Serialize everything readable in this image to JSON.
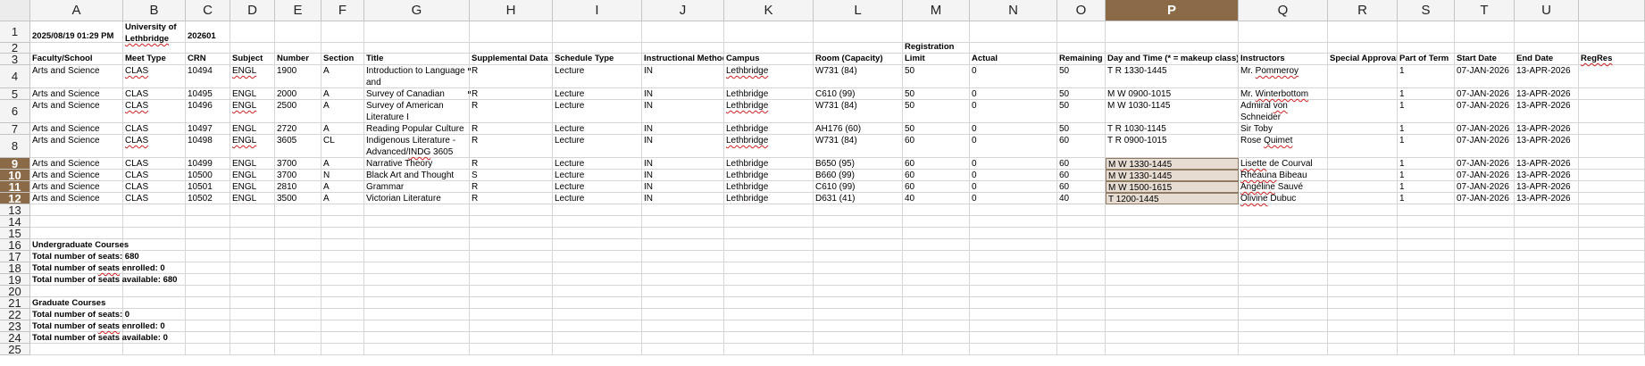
{
  "sheet": {
    "active_column": "P",
    "active_rows": [
      9,
      10,
      11,
      12
    ],
    "columns": [
      "A",
      "B",
      "C",
      "D",
      "E",
      "F",
      "G",
      "H",
      "I",
      "J",
      "K",
      "L",
      "M",
      "N",
      "O",
      "P",
      "Q",
      "R",
      "S",
      "T",
      "U"
    ],
    "rows": [
      1,
      2,
      3,
      4,
      5,
      6,
      7,
      8,
      9,
      10,
      11,
      12,
      13,
      14,
      15,
      16,
      17,
      18,
      19,
      20,
      21,
      22,
      23,
      24,
      25
    ],
    "meta_row": {
      "A": "2025/08/19 01:29 PM",
      "B": "University of Lethbridge",
      "C": "202601"
    },
    "headers": {
      "A": "Faculty/School",
      "B": "Meet Type",
      "C": "CRN",
      "D": "Subject",
      "E": "Number",
      "F": "Section",
      "G": "Title",
      "H": "Supplemental Data",
      "I": "Schedule Type",
      "J": "Instructional Method",
      "K": "Campus",
      "L": "Room (Capacity)",
      "M": "Registration Limit",
      "N": "Actual",
      "O": "Remaining",
      "P": "Day and Time (* = makeup class)",
      "Q": "Instructors",
      "R": "Special Approval",
      "S": "Part of Term",
      "T": "Start Date",
      "U": "End Date",
      "V": "RegRes"
    },
    "data_rows": [
      {
        "row": 4,
        "A": "Arts and Science",
        "B": "CLAS",
        "C": "10494",
        "D": "ENGL",
        "E": "1900",
        "F": "A",
        "G": "Introduction to Language and",
        "H": "R",
        "I": "Lecture",
        "J": "IN",
        "K": "Lethbridge",
        "L": "W731 (84)",
        "M": "50",
        "N": "0",
        "O": "50",
        "P": "T R  1330-1445",
        "Q": "Mr. Pommeroy",
        "S": "1",
        "T": "07-JAN-2026",
        "U": "13-APR-2026"
      },
      {
        "row": 5,
        "A": "Arts and Science",
        "B": "CLAS",
        "C": "10495",
        "D": "ENGL",
        "E": "2000",
        "F": "A",
        "G": "Survey of Canadian",
        "H": "R",
        "I": "Lecture",
        "J": "IN",
        "K": "Lethbridge",
        "L": "C610 (99)",
        "M": "50",
        "N": "0",
        "O": "50",
        "P": "M W   0900-1015",
        "Q": "Mr. Winterbottom",
        "S": "1",
        "T": "07-JAN-2026",
        "U": "13-APR-2026"
      },
      {
        "row": 6,
        "A": "Arts and Science",
        "B": "CLAS",
        "C": "10496",
        "D": "ENGL",
        "E": "2500",
        "F": "A",
        "G": "Survey of American Literature I",
        "H": "R",
        "I": "Lecture",
        "J": "IN",
        "K": "Lethbridge",
        "L": "W731 (84)",
        "M": "50",
        "N": "0",
        "O": "50",
        "P": "M W   1030-1145",
        "Q": "Admiral von Schneider",
        "S": "1",
        "T": "07-JAN-2026",
        "U": "13-APR-2026"
      },
      {
        "row": 7,
        "A": "Arts and Science",
        "B": "CLAS",
        "C": "10497",
        "D": "ENGL",
        "E": "2720",
        "F": "A",
        "G": "Reading Popular Culture",
        "H": "R",
        "I": "Lecture",
        "J": "IN",
        "K": "Lethbridge",
        "L": "AH176 (60)",
        "M": "50",
        "N": "0",
        "O": "50",
        "P": "T R  1030-1145",
        "Q": "Sir Toby",
        "S": "1",
        "T": "07-JAN-2026",
        "U": "13-APR-2026"
      },
      {
        "row": 8,
        "A": "Arts and Science",
        "B": "CLAS",
        "C": "10498",
        "D": "ENGL",
        "E": "3605",
        "F": "CL",
        "G": "Indigenous Literature - Advanced/INDG 3605",
        "H": "R",
        "I": "Lecture",
        "J": "IN",
        "K": "Lethbridge",
        "L": "W731 (84)",
        "M": "60",
        "N": "0",
        "O": "60",
        "P": "T R  0900-1015",
        "Q": "Rose Quimet",
        "S": "1",
        "T": "07-JAN-2026",
        "U": "13-APR-2026"
      },
      {
        "row": 9,
        "A": "Arts and Science",
        "B": "CLAS",
        "C": "10499",
        "D": "ENGL",
        "E": "3700",
        "F": "A",
        "G": "Narrative Theory",
        "H": "R",
        "I": "Lecture",
        "J": "IN",
        "K": "Lethbridge",
        "L": "B650 (95)",
        "M": "60",
        "N": "0",
        "O": "60",
        "P": "M W   1330-1445",
        "Q": "Lisette de Courval",
        "S": "1",
        "T": "07-JAN-2026",
        "U": "13-APR-2026"
      },
      {
        "row": 10,
        "A": "Arts and Science",
        "B": "CLAS",
        "C": "10500",
        "D": "ENGL",
        "E": "3700",
        "F": "N",
        "G": "Black Art and Thought",
        "H": "S",
        "I": "Lecture",
        "J": "IN",
        "K": "Lethbridge",
        "L": "B660 (99)",
        "M": "60",
        "N": "0",
        "O": "60",
        "P": "M W   1330-1445",
        "Q": "Rhéauna Bibeau",
        "S": "1",
        "T": "07-JAN-2026",
        "U": "13-APR-2026"
      },
      {
        "row": 11,
        "A": "Arts and Science",
        "B": "CLAS",
        "C": "10501",
        "D": "ENGL",
        "E": "2810",
        "F": "A",
        "G": "Grammar",
        "H": "R",
        "I": "Lecture",
        "J": "IN",
        "K": "Lethbridge",
        "L": "C610 (99)",
        "M": "60",
        "N": "0",
        "O": "60",
        "P": "M W   1500-1615",
        "Q": "Angéline Sauvé",
        "S": "1",
        "T": "07-JAN-2026",
        "U": "13-APR-2026"
      },
      {
        "row": 12,
        "A": "Arts and Science",
        "B": "CLAS",
        "C": "10502",
        "D": "ENGL",
        "E": "3500",
        "F": "A",
        "G": "Victorian Literature",
        "H": "R",
        "I": "Lecture",
        "J": "IN",
        "K": "Lethbridge",
        "L": "D631 (41)",
        "M": "40",
        "N": "0",
        "O": "40",
        "P": "T   1200-1445",
        "Q": "Olivine Dubuc",
        "S": "1",
        "T": "07-JAN-2026",
        "U": "13-APR-2026"
      }
    ],
    "summary": [
      {
        "row": 16,
        "text": "Undergraduate Courses"
      },
      {
        "row": 17,
        "text": "Total number of seats: 680"
      },
      {
        "row": 18,
        "text": "Total number of  seats enrolled: 0"
      },
      {
        "row": 19,
        "text": "Total number of seats available: 680"
      },
      {
        "row": 21,
        "text": "Graduate Courses"
      },
      {
        "row": 22,
        "text": "Total number of seats: 0"
      },
      {
        "row": 23,
        "text": "Total number of  seats enrolled: 0"
      },
      {
        "row": 24,
        "text": "Total number of seats available: 0"
      }
    ]
  }
}
